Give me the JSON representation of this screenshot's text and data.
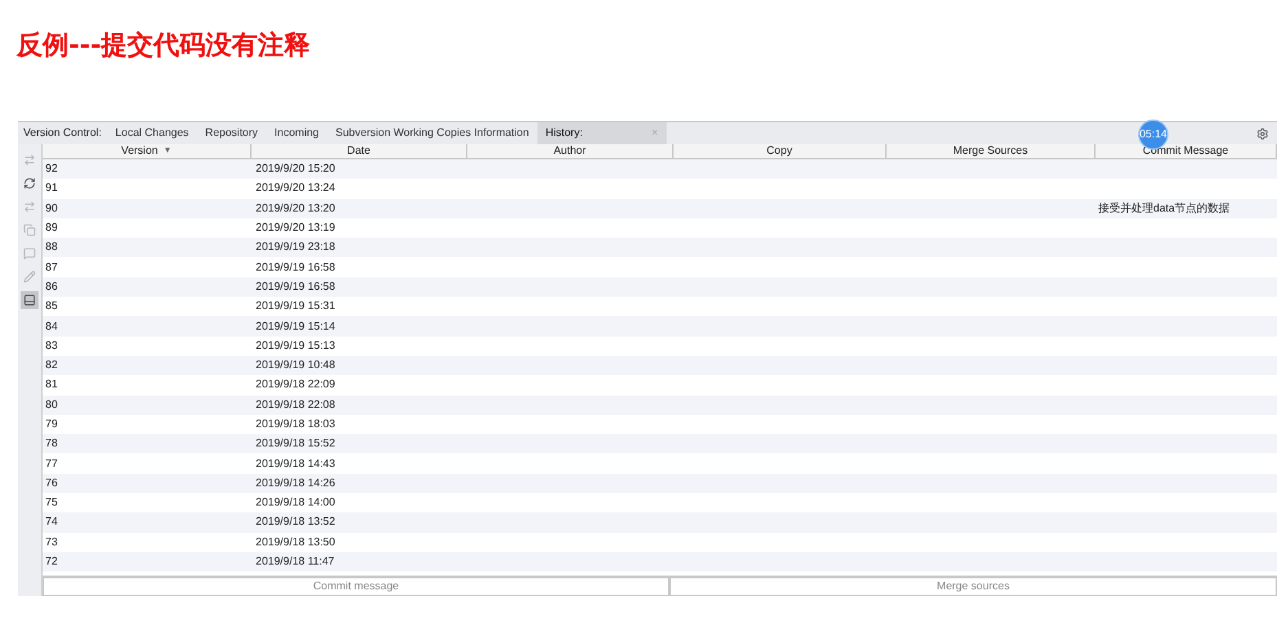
{
  "heading": "反例---提交代码没有注释",
  "tabs": [
    {
      "label": "Version Control:",
      "kind": "caption"
    },
    {
      "label": "Local Changes",
      "kind": "tab",
      "selected": false
    },
    {
      "label": "Repository",
      "kind": "tab",
      "selected": false
    },
    {
      "label": "Incoming",
      "kind": "tab",
      "selected": false
    },
    {
      "label": "Subversion Working Copies Information",
      "kind": "tab",
      "selected": false
    },
    {
      "label": "History:",
      "kind": "closable",
      "selected": true,
      "close": "×"
    }
  ],
  "timer_badge": "05:14",
  "toolbar": [
    {
      "disabled": true,
      "selected": false
    },
    {
      "disabled": false,
      "selected": false
    },
    {
      "disabled": true,
      "selected": false
    },
    {
      "disabled": true,
      "selected": false
    },
    {
      "disabled": true,
      "selected": false
    },
    {
      "disabled": true,
      "selected": false
    },
    {
      "disabled": false,
      "selected": true
    }
  ],
  "table": {
    "columns": [
      {
        "label": "Version",
        "sort": "▼"
      },
      {
        "label": "Date"
      },
      {
        "label": "Author"
      },
      {
        "label": "Copy"
      },
      {
        "label": "Merge Sources"
      },
      {
        "label": "Commit Message"
      }
    ],
    "rows": [
      {
        "version": "92",
        "date": "2019/9/20 15:20"
      },
      {
        "version": "91",
        "date": "2019/9/20 13:24"
      },
      {
        "version": "90",
        "date": "2019/9/20 13:20",
        "commit_message": "接受并处理data节点的数据"
      },
      {
        "version": "89",
        "date": "2019/9/20 13:19"
      },
      {
        "version": "88",
        "date": "2019/9/19 23:18"
      },
      {
        "version": "87",
        "date": "2019/9/19 16:58"
      },
      {
        "version": "86",
        "date": "2019/9/19 16:58"
      },
      {
        "version": "85",
        "date": "2019/9/19 15:31"
      },
      {
        "version": "84",
        "date": "2019/9/19 15:14"
      },
      {
        "version": "83",
        "date": "2019/9/19 15:13"
      },
      {
        "version": "82",
        "date": "2019/9/19 10:48"
      },
      {
        "version": "81",
        "date": "2019/9/18 22:09"
      },
      {
        "version": "80",
        "date": "2019/9/18 22:08"
      },
      {
        "version": "79",
        "date": "2019/9/18 18:03"
      },
      {
        "version": "78",
        "date": "2019/9/18 15:52"
      },
      {
        "version": "77",
        "date": "2019/9/18 14:43"
      },
      {
        "version": "76",
        "date": "2019/9/18 14:26"
      },
      {
        "version": "75",
        "date": "2019/9/18 14:00"
      },
      {
        "version": "74",
        "date": "2019/9/18 13:52"
      },
      {
        "version": "73",
        "date": "2019/9/18 13:50"
      },
      {
        "version": "72",
        "date": "2019/9/18 11:47"
      }
    ]
  },
  "bottom_panels": [
    {
      "label": "Commit message"
    },
    {
      "label": "Merge sources"
    }
  ]
}
